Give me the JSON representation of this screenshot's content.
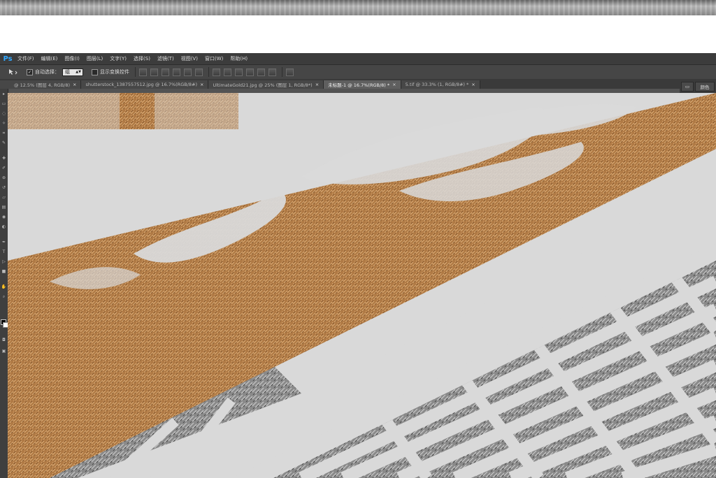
{
  "app": {
    "logo": "Ps"
  },
  "menubar": {
    "items": [
      {
        "label": "文件(F)"
      },
      {
        "label": "编辑(E)"
      },
      {
        "label": "图像(I)"
      },
      {
        "label": "图层(L)"
      },
      {
        "label": "文字(Y)"
      },
      {
        "label": "选择(S)"
      },
      {
        "label": "滤镜(T)"
      },
      {
        "label": "视图(V)"
      },
      {
        "label": "窗口(W)"
      },
      {
        "label": "帮助(H)"
      }
    ]
  },
  "options": {
    "auto_select_label": "自动选择：",
    "auto_select_checked": true,
    "auto_select_value": "组",
    "show_transform_label": "显示变换控件"
  },
  "tabs": [
    {
      "label": "@ 12.5% (图层 4, RGB/8)",
      "active": false
    },
    {
      "label": "shutterstock_1387557512.jpg @ 16.7%(RGB/8#)",
      "active": false
    },
    {
      "label": "UltimateGold21.jpg @ 25% (图层 1, RGB/8*)",
      "active": false
    },
    {
      "label": "未标题-1 @ 16.7%(RGB/8) *",
      "active": true
    },
    {
      "label": "5.tif @ 33.3% (1, RGB/8#) *",
      "active": false
    }
  ],
  "tab_close_glyph": "×",
  "panel": {
    "label": "颜色"
  },
  "icons": [
    "move-tool-icon",
    "checkbox-icon",
    "dropdown-icon",
    "align-icon",
    "panel-arrange-icon"
  ],
  "colors": {
    "ps_blue": "#31a8ff",
    "gold": "#b07a45",
    "canvas_gray": "#d9d9d9",
    "stripe_gray": "#7a7a7a"
  }
}
